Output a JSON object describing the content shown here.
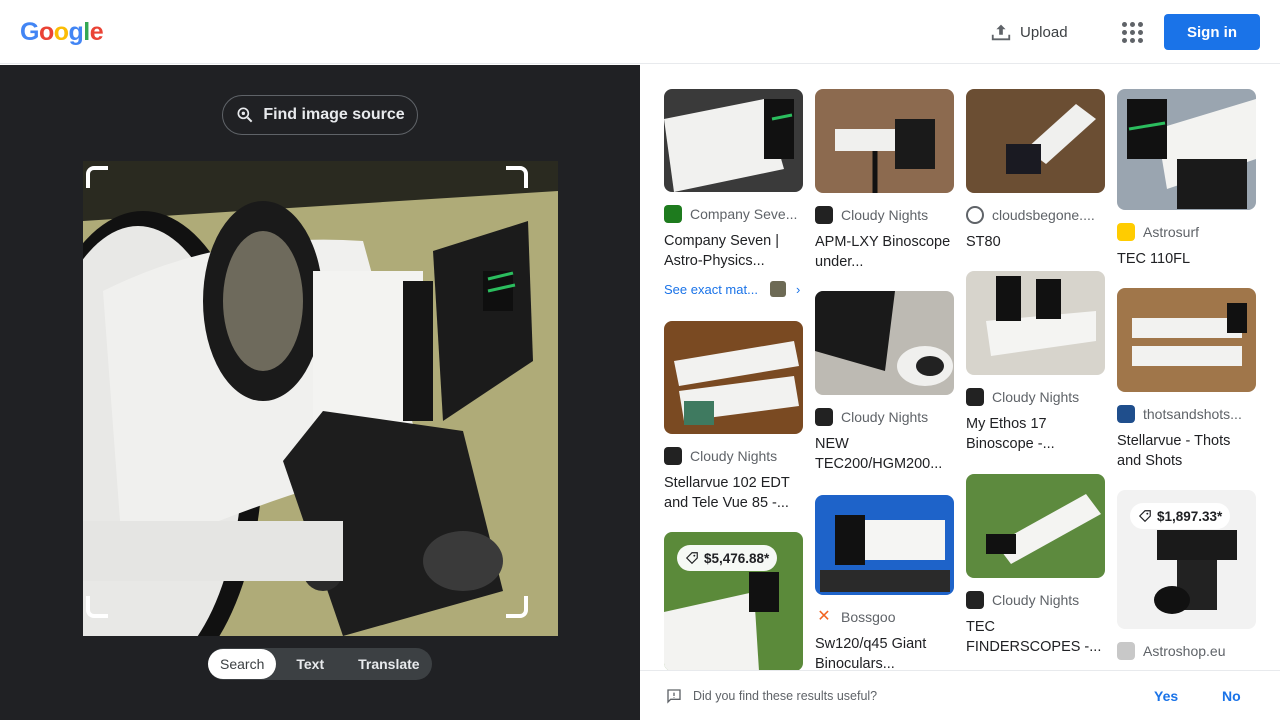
{
  "header": {
    "logo_letters": [
      {
        "ch": "G",
        "color": "#4285f4"
      },
      {
        "ch": "o",
        "color": "#ea4335"
      },
      {
        "ch": "o",
        "color": "#fbbc05"
      },
      {
        "ch": "g",
        "color": "#4285f4"
      },
      {
        "ch": "l",
        "color": "#34a853"
      },
      {
        "ch": "e",
        "color": "#ea4335"
      }
    ],
    "upload_label": "Upload",
    "signin_label": "Sign in"
  },
  "left": {
    "find_source_label": "Find image source",
    "tabs": [
      {
        "label": "Search",
        "active": true
      },
      {
        "label": "Text",
        "active": false
      },
      {
        "label": "Translate",
        "active": false
      }
    ]
  },
  "results": {
    "col1": [
      {
        "source": "Company Seve...",
        "title": "Company Seven | Astro-Physics...",
        "see_exact": "See exact mat..."
      },
      {
        "source": "Cloudy Nights",
        "title": "Stellarvue 102 EDT and Tele Vue 85 -..."
      },
      {
        "price": "$5,476.88*"
      }
    ],
    "col2": [
      {
        "source": "Cloudy Nights",
        "title": "APM-LXY Binoscope under..."
      },
      {
        "source": "Cloudy Nights",
        "title": "NEW TEC200/HGM200..."
      },
      {
        "source": "Bossgoo",
        "title": "Sw120/q45 Giant Binoculars..."
      }
    ],
    "col3": [
      {
        "source": "cloudsbegone....",
        "title": "ST80"
      },
      {
        "source": "Cloudy Nights",
        "title": "My Ethos 17 Binoscope -..."
      },
      {
        "source": "Cloudy Nights",
        "title": "TEC FINDERSCOPES -..."
      }
    ],
    "col4": [
      {
        "source": "Astrosurf",
        "title": "TEC 110FL"
      },
      {
        "source": "thotsandshots...",
        "title": "Stellarvue - Thots and Shots"
      },
      {
        "price": "$1,897.33*",
        "source": "Astroshop.eu"
      }
    ]
  },
  "feedback": {
    "question": "Did you find these results useful?",
    "yes": "Yes",
    "no": "No"
  }
}
